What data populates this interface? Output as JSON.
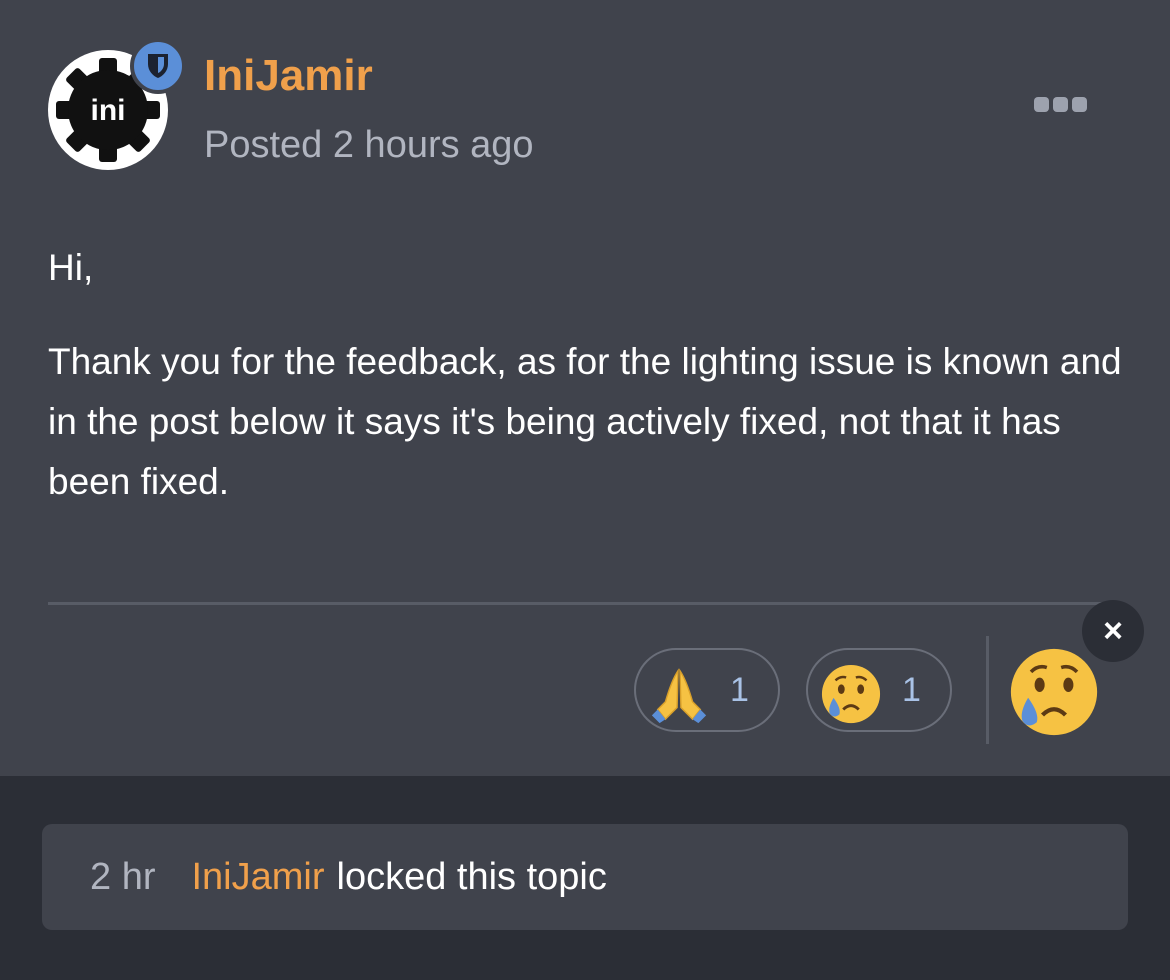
{
  "post": {
    "author": "IniJamir",
    "posted": "Posted 2 hours ago",
    "avatar": {
      "logo_text": "ini",
      "icon": "gear-logo"
    },
    "badge_icon": "shield-icon",
    "menu_icon": "more-icon",
    "body": {
      "greeting": "Hi,",
      "paragraph": "Thank you for the feedback, as for the lighting issue is known and in the post below it says it's being actively fixed, not that it has been fixed."
    },
    "reactions": [
      {
        "emoji": "folded-hands",
        "count": "1"
      },
      {
        "emoji": "crying-face",
        "count": "1"
      }
    ],
    "my_reaction": "crying-face",
    "close_label": "×"
  },
  "event": {
    "time": "2 hr",
    "user": "IniJamir",
    "action": "locked this topic"
  },
  "colors": {
    "background": "#2b2e36",
    "card": "#40434c",
    "accent": "#f0a04b",
    "badge": "#5b8fd8"
  }
}
